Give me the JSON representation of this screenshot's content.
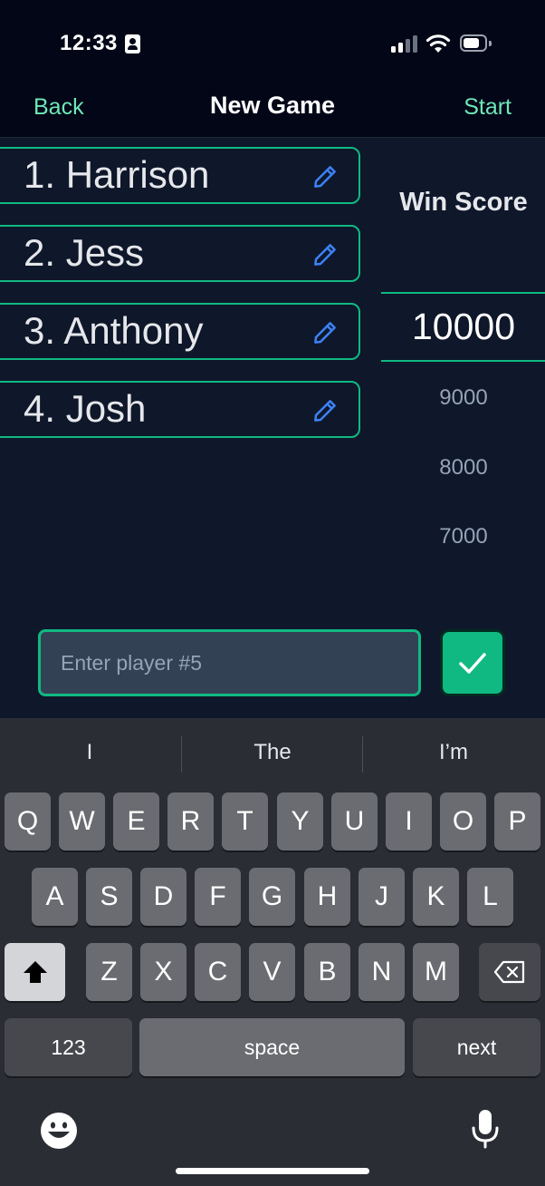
{
  "status_bar": {
    "time": "12:33",
    "icons": [
      "contact-card-icon",
      "cellular-signal-icon",
      "wifi-icon",
      "battery-icon"
    ]
  },
  "nav": {
    "back_label": "Back",
    "title": "New Game",
    "start_label": "Start"
  },
  "players": [
    {
      "name": "1. Harrison",
      "icon": "pencil-icon"
    },
    {
      "name": "2. Jess",
      "icon": "pencil-icon"
    },
    {
      "name": "3. Anthony",
      "icon": "pencil-icon"
    },
    {
      "name": "4. Josh",
      "icon": "pencil-icon"
    }
  ],
  "win_score": {
    "label": "Win Score",
    "selected": "10000",
    "options": [
      "9000",
      "8000",
      "7000"
    ]
  },
  "new_player_input": {
    "placeholder": "Enter player #5",
    "value": "",
    "confirm_icon": "checkmark-icon"
  },
  "keyboard": {
    "suggestions": [
      "I",
      "The",
      "I’m"
    ],
    "row1": [
      "Q",
      "W",
      "E",
      "R",
      "T",
      "Y",
      "U",
      "I",
      "O",
      "P"
    ],
    "row2": [
      "A",
      "S",
      "D",
      "F",
      "G",
      "H",
      "J",
      "K",
      "L"
    ],
    "row3": [
      "Z",
      "X",
      "C",
      "V",
      "B",
      "N",
      "M"
    ],
    "numbers_label": "123",
    "space_label": "space",
    "return_label": "next",
    "shift_icon": "shift-icon",
    "delete_icon": "backspace-icon",
    "emoji_icon": "emoji-icon",
    "mic_icon": "microphone-icon"
  },
  "colors": {
    "accent": "#10b981",
    "accent_text": "#6ee7b7",
    "background": "#0f172a",
    "header": "#020617",
    "pencil": "#3b82f6",
    "keyboard": "#2b2d34"
  }
}
